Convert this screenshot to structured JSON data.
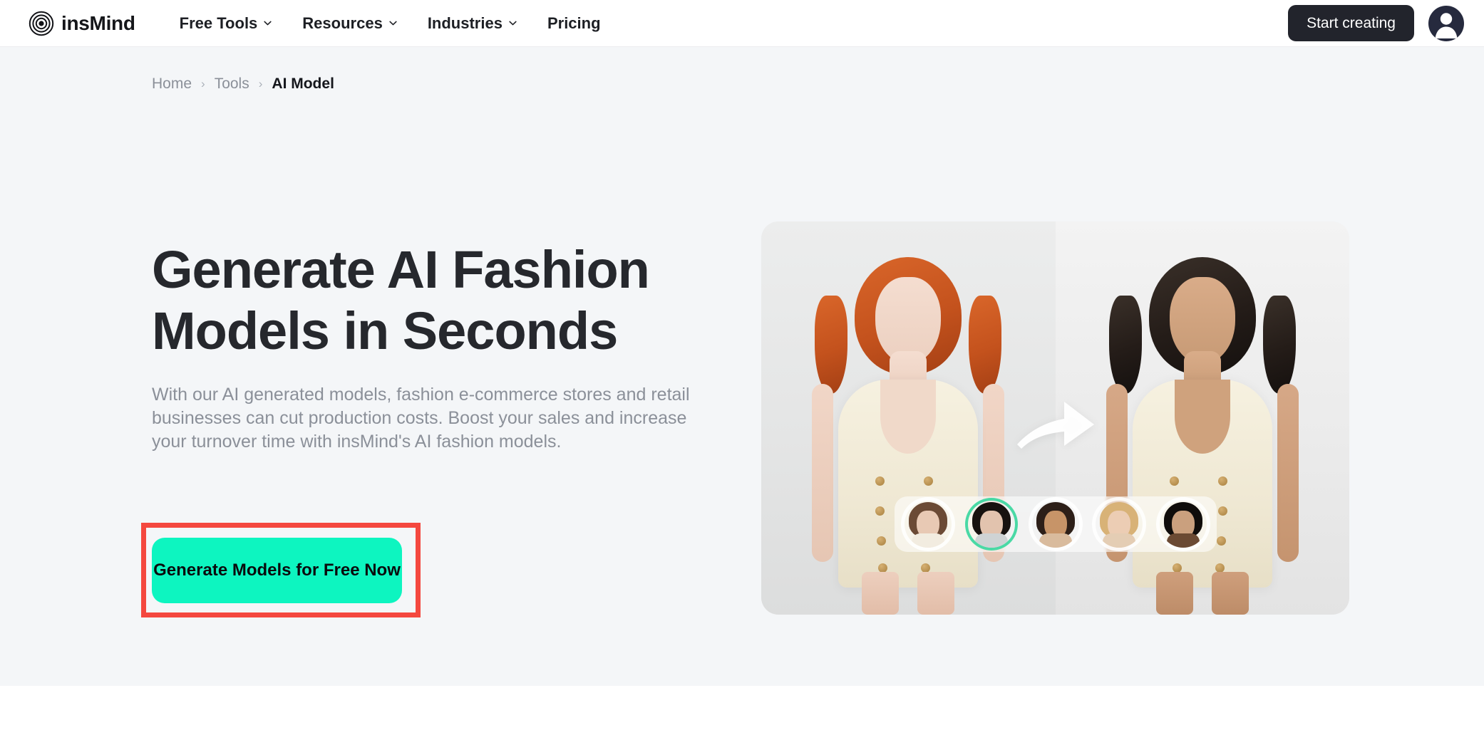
{
  "header": {
    "logo_icon": "concentric-circles-logo",
    "brand_name": "insMind",
    "nav": [
      {
        "label": "Free Tools",
        "has_dropdown": true,
        "icon": "chevron-down-icon"
      },
      {
        "label": "Resources",
        "has_dropdown": true,
        "icon": "chevron-down-icon"
      },
      {
        "label": "Industries",
        "has_dropdown": true,
        "icon": "chevron-down-icon"
      },
      {
        "label": "Pricing",
        "has_dropdown": false,
        "icon": ""
      }
    ],
    "start_button": "Start creating",
    "avatar_icon": "user-avatar-icon"
  },
  "breadcrumb": {
    "items": [
      {
        "label": "Home",
        "current": false
      },
      {
        "label": "Tools",
        "current": false
      },
      {
        "label": "AI Model",
        "current": true
      }
    ],
    "separator": "›"
  },
  "hero": {
    "title": "Generate AI Fashion Models in Seconds",
    "subtitle": "With our AI generated models, fashion e-commerce stores and retail businesses can cut production costs. Boost your sales and increase your turnover time with insMind's AI fashion models.",
    "cta_label": "Generate Models for Free Now",
    "image": {
      "alt": "Before and after AI fashion model face swap comparison",
      "arrow_icon": "curved-arrow-up-right-icon",
      "left_model": "Red-haired fashion model in cream sleeveless double-breasted romper",
      "right_model": "Dark-haired fashion model in the same cream romper",
      "face_selector": [
        {
          "name": "face-option-1",
          "selected": false,
          "hair": "#6b4a35",
          "skin": "#e8c9b4"
        },
        {
          "name": "face-option-2",
          "selected": true,
          "hair": "#17120f",
          "skin": "#e2c3ae"
        },
        {
          "name": "face-option-3",
          "selected": false,
          "hair": "#2d1f18",
          "skin": "#c79468"
        },
        {
          "name": "face-option-4",
          "selected": false,
          "hair": "#d8b277",
          "skin": "#eccdb4"
        },
        {
          "name": "face-option-5",
          "selected": false,
          "hair": "#100d0b",
          "skin": "#caa07e"
        }
      ]
    }
  },
  "annotation": {
    "type": "highlight-rectangle",
    "target": "Generate Models for Free Now button",
    "color": "#f4483f"
  },
  "colors": {
    "accent_green": "#0df5c0",
    "selection_ring": "#4ad9a5",
    "dark": "#22242c",
    "page_bg": "#f4f6f8",
    "muted_text": "#8b9099",
    "annotation_red": "#f4483f"
  }
}
